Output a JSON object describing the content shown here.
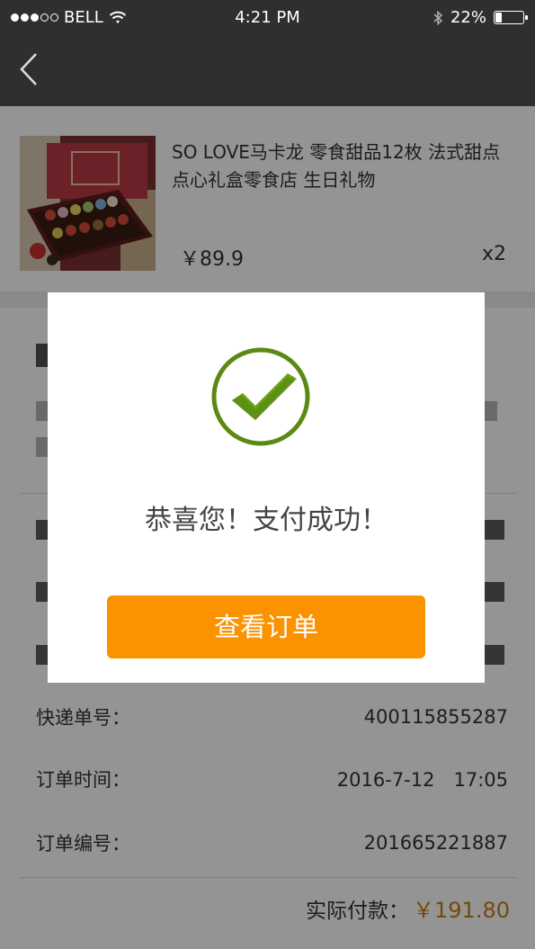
{
  "status_bar": {
    "carrier": "BELL",
    "time": "4:21 PM",
    "battery": "22%",
    "battery_level": 0.22,
    "signal_bars": 3,
    "signal_total": 5
  },
  "nav": {
    "back_icon": "chevron-left-icon"
  },
  "product": {
    "title": "SO LOVE马卡龙 零食甜品12枚 法式甜点点心礼盒零食店 生日礼物",
    "price": "￥89.9",
    "quantity": "x2"
  },
  "order_details": [
    {
      "label": "快递单号：",
      "value": "400115855287"
    },
    {
      "label": "订单时间：",
      "value": "2016-7-12　17:05"
    },
    {
      "label": "订单编号：",
      "value": "201665221887"
    }
  ],
  "total": {
    "label": "实际付款：",
    "amount": "￥191.80"
  },
  "dialog": {
    "icon": "check-circle-icon",
    "message": "恭喜您！支付成功！",
    "button_label": "查看订单"
  },
  "colors": {
    "accent": "#fb9200",
    "success_green": "#5a8a12",
    "price_orange": "#c67e14",
    "header_bg": "#2f2f2f"
  }
}
